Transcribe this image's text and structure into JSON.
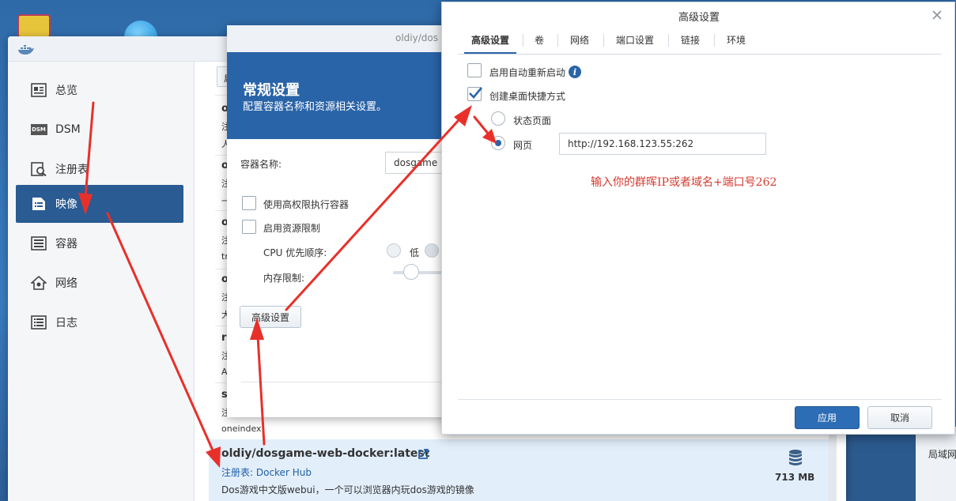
{
  "sidebar": {
    "items": [
      {
        "label": "总览",
        "icon": "overview-icon"
      },
      {
        "label": "DSM",
        "icon": "dsm-icon",
        "icon_text": "DSM"
      },
      {
        "label": "注册表",
        "icon": "registry-icon"
      },
      {
        "label": "映像",
        "icon": "image-icon",
        "active": true
      },
      {
        "label": "容器",
        "icon": "container-icon"
      },
      {
        "label": "网络",
        "icon": "network-icon"
      },
      {
        "label": "日志",
        "icon": "log-icon"
      }
    ]
  },
  "list": {
    "toolbar_stub": "启",
    "peek": [
      "o",
      "注",
      "人",
      "o",
      "注",
      "一",
      "o",
      "注",
      "tr",
      "o",
      "注",
      "大",
      "r",
      "注",
      "A",
      "s",
      "注"
    ],
    "prev_tail": "oneindex",
    "selected": {
      "title": "oldiy/dosgame-web-docker:latest",
      "registry": "注册表: Docker Hub",
      "description": "Dos游戏中文版webui，一个可以浏览器内玩dos游戏的镜像",
      "size": "713 MB"
    }
  },
  "general_dialog": {
    "window_title": "oldiy/dos",
    "title": "常规设置",
    "subtitle": "配置容器名称和资源相关设置。",
    "container_name_label": "容器名称:",
    "container_name_value": "dosgame",
    "privileged_label": "使用高权限执行容器",
    "resource_limit_label": "启用资源限制",
    "cpu_priority_label": "CPU 优先顺序:",
    "cpu_low_label": "低",
    "memory_limit_label": "内存限制:",
    "advanced_button": "高级设置"
  },
  "advanced_dialog": {
    "title": "高级设置",
    "tabs": [
      "高级设置",
      "卷",
      "网络",
      "端口设置",
      "链接",
      "环境"
    ],
    "auto_restart_label": "启用自动重新启动",
    "auto_restart_checked": false,
    "desktop_shortcut_label": "创建桌面快捷方式",
    "desktop_shortcut_checked": true,
    "status_page_label": "状态页面",
    "webpage_label": "网页",
    "webpage_url": "http://192.168.123.55:262",
    "annotation": "输入你的群晖IP或者域名+端口号262",
    "apply_button": "应用",
    "cancel_button": "取消"
  },
  "background": {
    "lan_label": "局域网"
  },
  "colors": {
    "accent": "#2a64a8",
    "active_nav": "#2a5b92",
    "annotation_red": "#d63a2f",
    "arrow_red": "#e8302a"
  }
}
